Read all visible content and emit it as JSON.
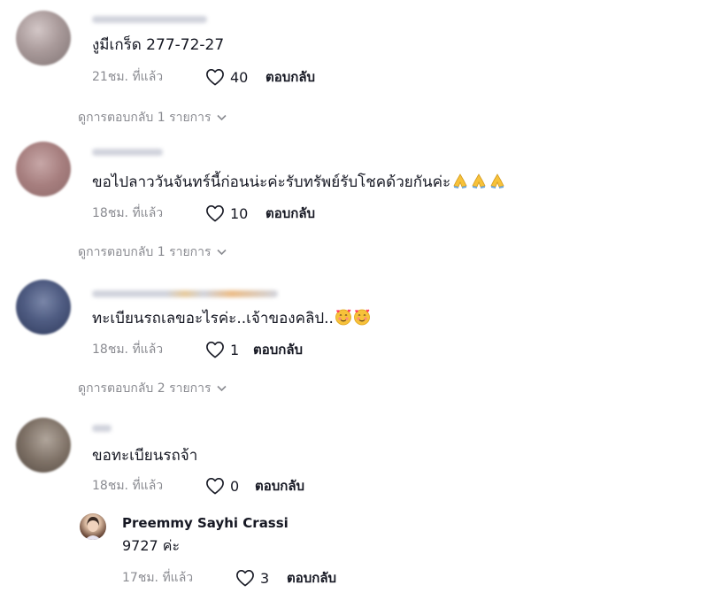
{
  "comments": [
    {
      "text": "งูมีเกร็ด 277-72-27",
      "time": "21ชม. ที่แล้ว",
      "likes": "40",
      "reply_label": "ตอบกลับ",
      "view_replies": "ดูการตอบกลับ 1 รายการ"
    },
    {
      "text": "ขอไปลาววันจันทร์นี้ก่อนน่ะค่ะรับทรัพย์รับโชคด้วยกันค่ะ",
      "emoji": [
        "folded-hands",
        "folded-hands",
        "folded-hands"
      ],
      "time": "18ชม. ที่แล้ว",
      "likes": "10",
      "reply_label": "ตอบกลับ",
      "view_replies": "ดูการตอบกลับ 1 รายการ"
    },
    {
      "text": "ทะเบียนรถเลขอะไรค่ะ..เจ้าของคลิป..",
      "emoji": [
        "smiling-face-with-hearts",
        "smiling-face-with-hearts"
      ],
      "time": "18ชม. ที่แล้ว",
      "likes": "1",
      "reply_label": "ตอบกลับ",
      "view_replies": "ดูการตอบกลับ 2 รายการ"
    },
    {
      "text": "ขอทะเบียนรถจ้า",
      "time": "18ชม. ที่แล้ว",
      "likes": "0",
      "reply_label": "ตอบกลับ"
    }
  ],
  "reply": {
    "username": "Preemmy Sayhi Crassi",
    "text": "9727 ค่ะ",
    "time": "17ชม. ที่แล้ว",
    "likes": "3",
    "reply_label": "ตอบกลับ"
  },
  "colors": {
    "text": "#161823",
    "muted": "#8a8b91",
    "emoji_yellow": "#f7c23a",
    "emoji_blush": "#ff6f61",
    "username_blur": "#c8cbd6"
  }
}
